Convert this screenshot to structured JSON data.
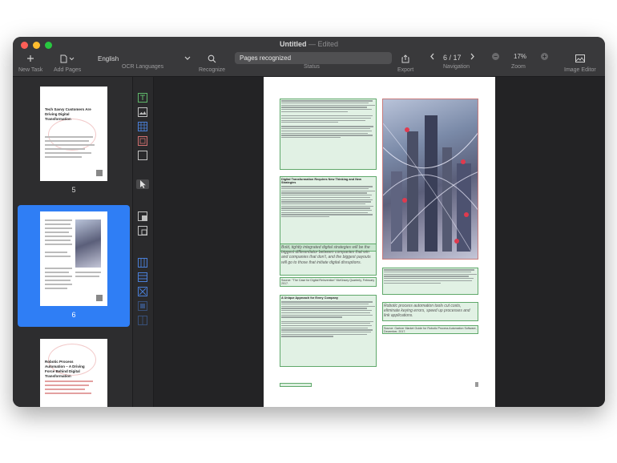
{
  "window": {
    "title": "Untitled",
    "subtitle": "Edited",
    "separator": "—"
  },
  "toolbar": {
    "new_task": {
      "label": "New Task",
      "icon": "plus-icon"
    },
    "add_pages": {
      "label": "Add Pages",
      "icon": "document-add-icon"
    },
    "ocr_languages": {
      "label": "OCR Languages",
      "value": "English"
    },
    "recognize": {
      "label": "Recognize",
      "icon": "magnifier-icon"
    },
    "status": {
      "label": "Status",
      "value": "Pages recognized"
    },
    "export": {
      "label": "Export",
      "icon": "share-icon"
    },
    "navigation": {
      "label": "Navigation",
      "page_indicator": "6 / 17"
    },
    "zoom": {
      "label": "Zoom",
      "value": "17%"
    },
    "image_editor": {
      "label": "Image Editor",
      "icon": "image-icon"
    }
  },
  "sidebar": {
    "thumbnails": [
      {
        "number": "5",
        "title": "Tech Savvy Customers Are Driving Digital Transformation",
        "selected": false
      },
      {
        "number": "6",
        "title": "",
        "selected": true
      },
      {
        "number": "7",
        "title": "Robotic Process Automation – A Driving Force Behind Digital Transformation",
        "selected": false
      }
    ]
  },
  "page": {
    "heading_1": "Digital Transformation Requires New Thinking and New Strategies",
    "quote_1": "Bold, tightly integrated digital strategies will be the biggest differentiator between companies that win and companies that don't, and the biggest payouts will go to those that initiate digital disruptions.",
    "source_1": "Source: \"The Case for Digital Reinvention\" McKinsey Quarterly, February 2017.",
    "heading_2": "A Unique Approach for Every Company",
    "quote_2": "Robotic process automation tools cut costs, eliminate keying errors, speed up processes and link applications.",
    "source_2": "Source: Gartner Market Guide for Robotic Process Automation Software, December, 2017."
  },
  "colors": {
    "accent": "#2f7ef5",
    "zone_border": "#5fa86a",
    "window_bg": "#2a2a2c",
    "toolbar_bg": "#39393b"
  }
}
